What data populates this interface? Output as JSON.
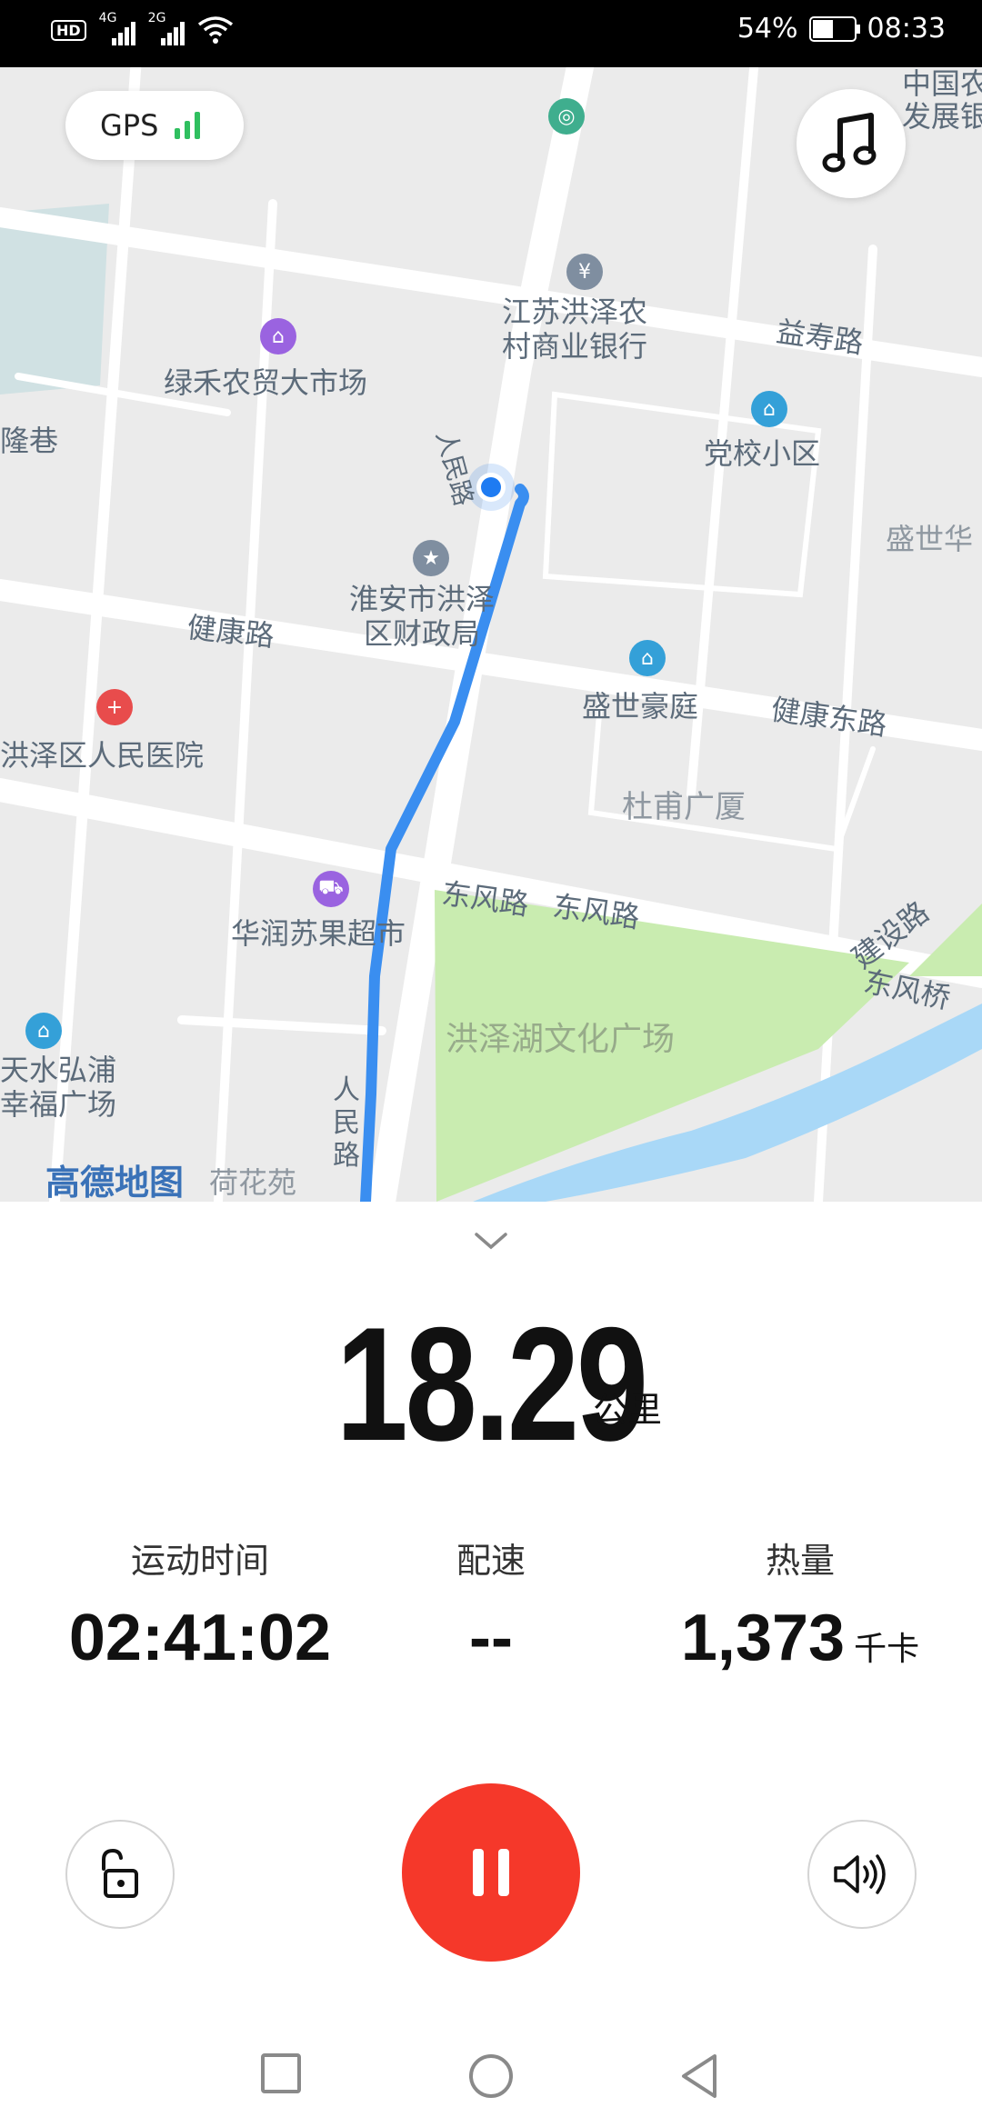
{
  "status_bar": {
    "hd": "HD",
    "sim1_type": "4G",
    "sim2_type": "2G",
    "battery_percent_label": "54%",
    "battery_level": 0.54,
    "time": "08:33"
  },
  "map": {
    "gps_label": "GPS",
    "labels": {
      "bank_name": "江苏洪泽农\n村商业银行",
      "market": "绿禾农贸大市场",
      "road_yishou": "益寿路",
      "dangxiao": "党校小区",
      "shengshi_right": "盛世华",
      "long_lane": "隆巷",
      "renmin_road_top": "人民路",
      "finance_bureau": "淮安市洪泽\n区财政局",
      "jiankang_road": "健康路",
      "shengshi_haoting": "盛世豪庭",
      "jiankang_east": "健康东路",
      "hospital": "洪泽区人民医院",
      "dufu_tower": "杜甫广厦",
      "dongfeng_road": "东风路",
      "dongfeng_road2": "东风路",
      "jianshe_road": "建设路",
      "dongfeng_bridge": "东风桥",
      "supermarket": "华润苏果超市",
      "culture_square": "洪泽湖文化广场",
      "shuiminpu": "天水弘浦\n幸福广场",
      "renmin_road_bottom": "人民路",
      "hehuayuan": "荷花苑",
      "amap_logo": "高德地图",
      "agri_bank": "中国农\n发展银"
    },
    "route_color": "#3a8ef0",
    "park_color": "#c9ecb0",
    "water_color": "#a9d8f7"
  },
  "workout": {
    "distance": "18.29",
    "distance_unit": "公里",
    "stats": [
      {
        "label": "运动时间",
        "value": "02:41:02",
        "unit": ""
      },
      {
        "label": "配速",
        "value": "--",
        "unit": ""
      },
      {
        "label": "热量",
        "value": "1,373",
        "unit": "千卡"
      }
    ]
  },
  "controls": {
    "lock": "unlock-icon",
    "pause": "pause-icon",
    "sound": "speaker-icon"
  },
  "colors": {
    "accent_red": "#f5382a",
    "gps_green": "#2fbf5f"
  }
}
